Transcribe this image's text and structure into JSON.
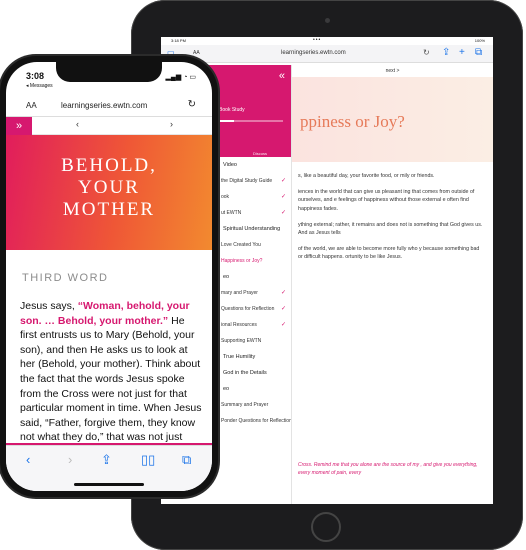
{
  "ipad": {
    "status": {
      "time": "3:18 PM",
      "dots": "•••",
      "battery": "100%"
    },
    "browser": {
      "text_size": "AA",
      "url": "learningseries.ewtn.com",
      "reload_icon": "reload-icon"
    },
    "sidebar": {
      "collapse_icon": "«",
      "title": "ine Book Study",
      "tabs": [
        "Learners",
        "Discuss"
      ],
      "items": [
        {
          "label": "Video",
          "type": "section",
          "checked": false
        },
        {
          "label": "the Digital Study Guide",
          "type": "item",
          "checked": true
        },
        {
          "label": "ook",
          "type": "item",
          "checked": true
        },
        {
          "label": "ut EWTN",
          "type": "item",
          "checked": true
        },
        {
          "label": "Spiritual Understanding",
          "type": "section",
          "checked": false
        },
        {
          "label": "Love Created You",
          "type": "item",
          "checked": false
        },
        {
          "label": "Happiness or Joy?",
          "type": "active",
          "checked": false
        },
        {
          "label": "eo",
          "type": "section",
          "checked": false
        },
        {
          "label": "mary and Prayer",
          "type": "item",
          "checked": true
        },
        {
          "label": "Questions for Reflection",
          "type": "item",
          "checked": true
        },
        {
          "label": "ional Resources",
          "type": "item",
          "checked": true
        },
        {
          "label": "Supporting EWTN",
          "type": "item",
          "checked": false
        },
        {
          "label": "True Humility",
          "type": "section",
          "checked": false
        },
        {
          "label": "God in the Details",
          "type": "section",
          "checked": false
        },
        {
          "label": "eo",
          "type": "section",
          "checked": false
        },
        {
          "label": "Summary and Prayer",
          "type": "item",
          "checked": false
        },
        {
          "label": "Ponder Questions for Reflection",
          "type": "item",
          "checked": false
        }
      ]
    },
    "main": {
      "next_label": "next >",
      "hero_title": "ppiness or Joy?",
      "paragraphs": [
        "s, like a beautiful day, your favorite food, or mily or friends.",
        "iences in the world that can give us pleasant ing that comes from outside of ourselves, and e feelings of happiness without those external e often find happiness fades.",
        "ything external; rather, it remains and does not is something that God gives us. And as Jesus tells",
        "of the world, we are able to become more fully who y because something bad or difficult happens. ortunity to be like Jesus."
      ],
      "prayer": "Cross. Remind me that you alone are the source of my , and give you everything, every moment of pain, every"
    }
  },
  "iphone": {
    "status": {
      "time": "3:08",
      "back_label": "◂ Messages"
    },
    "browser": {
      "text_size": "AA",
      "url": "learningseries.ewtn.com"
    },
    "nav": {
      "menu_icon": "»",
      "prev": "‹",
      "next": "›"
    },
    "hero_lines": [
      "BEHOLD,",
      "YOUR",
      "MOTHER"
    ],
    "section_label": "THIRD WORD",
    "body": {
      "intro": "Jesus says, ",
      "quote": "“Woman, behold, your son. … Behold, your mother.”",
      "rest": " He first entrusts us to Mary (Behold, your son), and then He asks us to look at her (Behold, your mother). Think about the fact that the words Jesus spoke from the Cross were not just for that particular moment in time. When Jesus said, “Father, forgive them, they know not what they do,” that was not just"
    },
    "toolbar": [
      "back-icon",
      "forward-icon",
      "share-icon",
      "bookmarks-icon",
      "tabs-icon"
    ]
  },
  "colors": {
    "brand": "#d6186f",
    "hero_orange": "#ef5736",
    "link_blue": "#1a73e8"
  }
}
